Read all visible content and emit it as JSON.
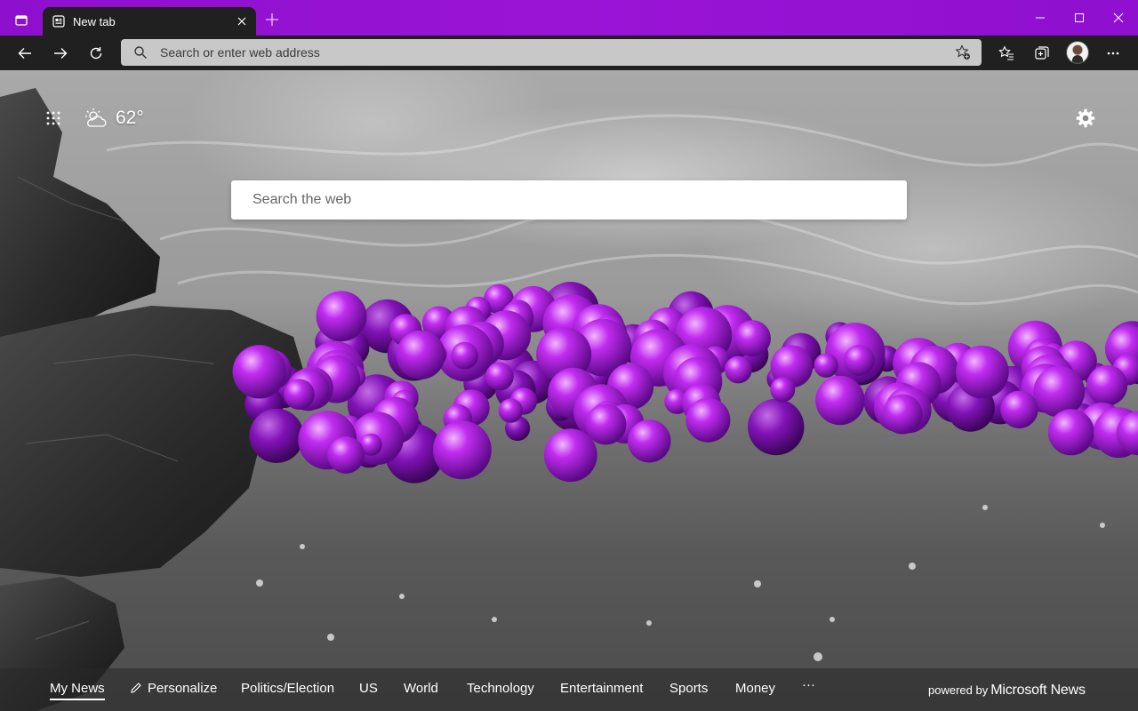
{
  "browser": {
    "tab": {
      "title": "New tab"
    },
    "address_bar": {
      "placeholder": "Search or enter web address"
    }
  },
  "icons": {
    "tab_actions": "tab-actions-icon",
    "favicon": "new-tab-page-icon",
    "close_tab": "close-icon",
    "new_tab": "plus-icon",
    "minimize": "minimize-icon",
    "maximize": "maximize-icon",
    "close_window": "close-window-icon",
    "back": "back-arrow-icon",
    "forward": "forward-arrow-icon",
    "refresh": "refresh-icon",
    "address_search": "search-icon",
    "add_favorite": "add-favorite-star-icon",
    "favorites": "favorites-icon",
    "collections": "collections-icon",
    "profile": "avatar",
    "more": "more-icon",
    "apps": "app-launcher-grid-icon",
    "weather": "partly-cloudy-icon",
    "settings": "gear-icon",
    "personalize": "pencil-icon"
  },
  "weather": {
    "temperature": "62°"
  },
  "search": {
    "placeholder": "Search the web"
  },
  "news_nav": {
    "items": [
      {
        "label": "My News"
      },
      {
        "label": "Personalize"
      },
      {
        "label": "Politics/Election"
      },
      {
        "label": "US"
      },
      {
        "label": "World"
      },
      {
        "label": "Technology"
      },
      {
        "label": "Entertainment"
      },
      {
        "label": "Sports"
      },
      {
        "label": "Money"
      },
      {
        "label": "···"
      }
    ],
    "active_item": "My News",
    "powered_by": "powered by",
    "brand": "Microsoft News"
  },
  "colors": {
    "titlebar_accent": "#9a14d6",
    "toolbar": "#202020",
    "balloon": "#b31ee6"
  }
}
